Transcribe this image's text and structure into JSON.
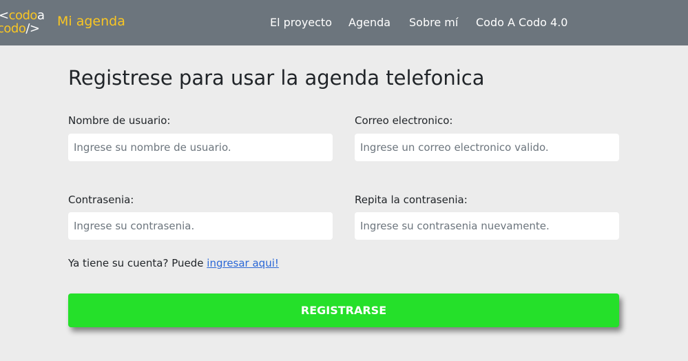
{
  "navbar": {
    "logo": {
      "row1_bracket": "<",
      "row1_word": "codo",
      "row1_letter": "a",
      "row2_word": "codo",
      "row2_slash": "/>"
    },
    "brand": "Mi agenda",
    "links": [
      "El proyecto",
      "Agenda",
      "Sobre mí",
      "Codo A Codo 4.0"
    ]
  },
  "form": {
    "title": "Registrese para usar la agenda telefonica",
    "username": {
      "label": "Nombre de usuario:",
      "placeholder": "Ingrese su nombre de usuario."
    },
    "email": {
      "label": "Correo electronico:",
      "placeholder": "Ingrese un correo electronico valido."
    },
    "password": {
      "label": "Contrasenia:",
      "placeholder": "Ingrese su contrasenia."
    },
    "password_repeat": {
      "label": "Repita la contrasenia:",
      "placeholder": "Ingrese su contrasenia nuevamente."
    },
    "login_prompt": "Ya tiene su cuenta? Puede",
    "login_link": "ingresar aqui!",
    "submit_label": "REGISTRARSE"
  },
  "colors": {
    "navbar_bg": "#6c757d",
    "brand_yellow": "#f9c623",
    "page_bg": "#ececec",
    "submit_green": "#25e02a",
    "link_blue": "#2a67d6"
  }
}
